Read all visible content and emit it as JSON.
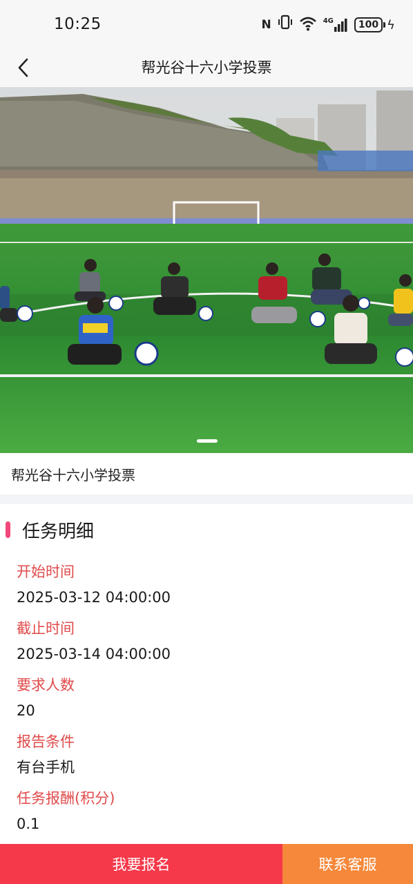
{
  "status_bar": {
    "time": "10:25",
    "nfc": "N",
    "vibrate": "▯",
    "wifi": "wifi-icon",
    "network": "4G",
    "battery": "100"
  },
  "nav": {
    "title": "帮光谷十六小学投票",
    "back_icon": "chevron-left-icon"
  },
  "banner": {
    "image_subject": "football-field-photo"
  },
  "caption": "帮光谷十六小学投票",
  "section": {
    "title": "任务明细",
    "fields": [
      {
        "label": "开始时间",
        "value": "2025-03-12 04:00:00"
      },
      {
        "label": "截止时间",
        "value": "2025-03-14 04:00:00"
      },
      {
        "label": "要求人数",
        "value": "20"
      },
      {
        "label": "报告条件",
        "value": "有台手机"
      },
      {
        "label": "任务报酬(积分)",
        "value": "0.1"
      }
    ]
  },
  "actions": {
    "signup": "我要报名",
    "contact": "联系客服"
  },
  "colors": {
    "accent": "#f0487c",
    "label_red": "#e04a4a",
    "signup_bg": "#f5394a",
    "contact_bg": "#f5883a"
  }
}
